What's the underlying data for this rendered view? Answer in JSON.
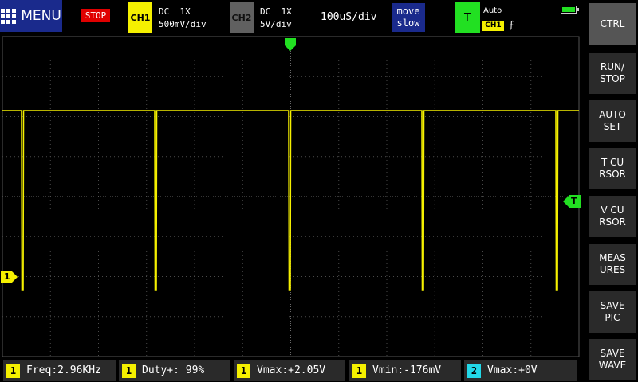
{
  "header": {
    "menu_label": "MENU",
    "status": "STOP",
    "ch1": {
      "tag": "CH1",
      "coupling": "DC  1X",
      "scale": "500mV/div"
    },
    "ch2": {
      "tag": "CH2",
      "coupling": "DC  1X",
      "scale": "5V/div"
    },
    "timebase": "100uS/div",
    "move": {
      "line1": "move",
      "line2": "slow"
    },
    "trigger": {
      "tag": "T",
      "mode": "Auto",
      "source": "CH1",
      "edge": "⨍"
    }
  },
  "markers": {
    "ch1": "1",
    "trigger_level": "T"
  },
  "colors": {
    "ch1": "#f5f000",
    "ch2": "#22d8e8",
    "trigger": "#22e022",
    "grid": "#555555"
  },
  "side_buttons": [
    "CTRL",
    "RUN/\nSTOP",
    "AUTO\nSET",
    "T CU\nRSOR",
    "V CU\nRSOR",
    "MEAS\nURES",
    "SAVE\nPIC",
    "SAVE\nWAVE"
  ],
  "measurements": [
    {
      "ch": "1",
      "label": "Freq",
      "value": ":2.96KHz"
    },
    {
      "ch": "1",
      "label": "Duty+",
      "value": ": 99%"
    },
    {
      "ch": "1",
      "label": "Vmax",
      "value": ":+2.05V"
    },
    {
      "ch": "1",
      "label": "Vmin",
      "value": ":-176mV"
    },
    {
      "ch": "2",
      "label": "Vmax",
      "value": ":+0V"
    }
  ]
}
